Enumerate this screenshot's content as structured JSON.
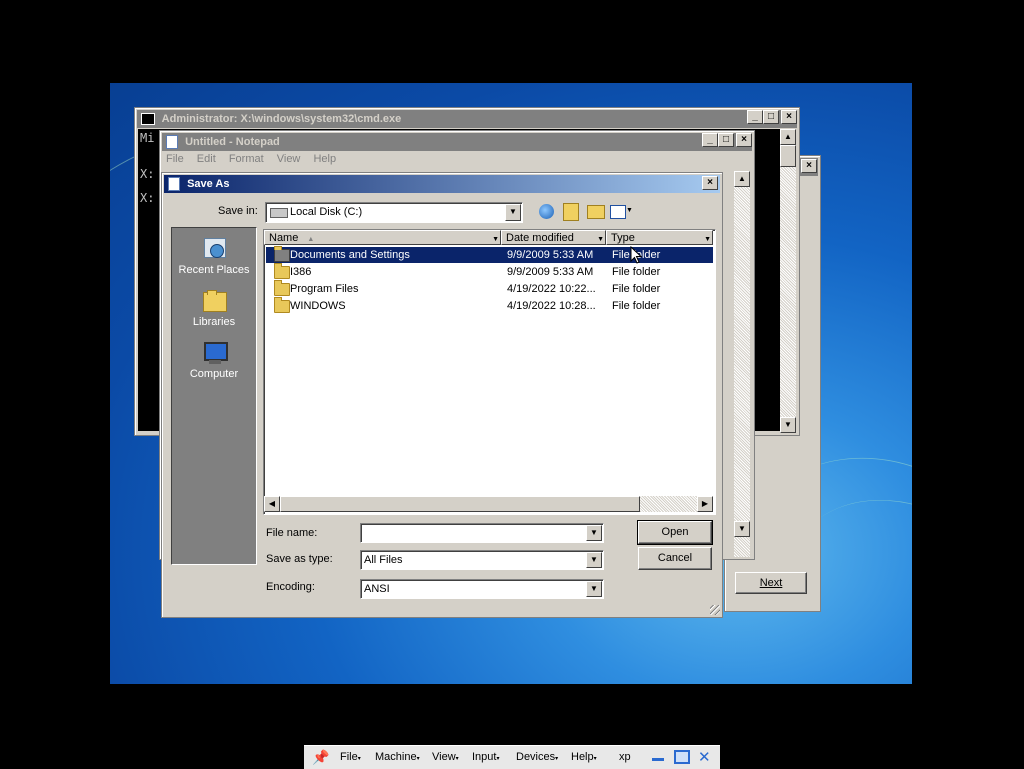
{
  "cmd_window": {
    "title": "Administrator: X:\\windows\\system32\\cmd.exe",
    "lines": [
      "Mi",
      "X:",
      "X:"
    ]
  },
  "notepad": {
    "title": "Untitled - Notepad",
    "menu": [
      "File",
      "Edit",
      "Format",
      "View",
      "Help"
    ]
  },
  "setup_window": {
    "next_label": "Next"
  },
  "save_as": {
    "title": "Save As",
    "save_in_label": "Save in:",
    "save_in_value": "Local Disk (C:)",
    "places": [
      {
        "label": "Recent Places",
        "icon": "recent-places-icon"
      },
      {
        "label": "Libraries",
        "icon": "libraries-icon"
      },
      {
        "label": "Computer",
        "icon": "computer-icon"
      }
    ],
    "columns": [
      "Name",
      "Date modified",
      "Type"
    ],
    "files": [
      {
        "name": "Documents and Settings",
        "date": "9/9/2009 5:33 AM",
        "type": "File folder",
        "selected": true
      },
      {
        "name": "I386",
        "date": "9/9/2009 5:33 AM",
        "type": "File folder",
        "selected": false
      },
      {
        "name": "Program Files",
        "date": "4/19/2022 10:22...",
        "type": "File folder",
        "selected": false
      },
      {
        "name": "WINDOWS",
        "date": "4/19/2022 10:28...",
        "type": "File folder",
        "selected": false
      }
    ],
    "file_name_label": "File name:",
    "file_name_value": "",
    "save_type_label": "Save as type:",
    "save_type_value": "All Files",
    "encoding_label": "Encoding:",
    "encoding_value": "ANSI",
    "open_label": "Open",
    "cancel_label": "Cancel"
  },
  "vbox_menu": {
    "items": [
      "File",
      "Machine",
      "View",
      "Input",
      "Devices",
      "Help"
    ],
    "vm_name": "xp"
  },
  "colors": {
    "selection": "#0a246a",
    "caption_active": "#0a246a",
    "desktop": "#1264c4"
  }
}
